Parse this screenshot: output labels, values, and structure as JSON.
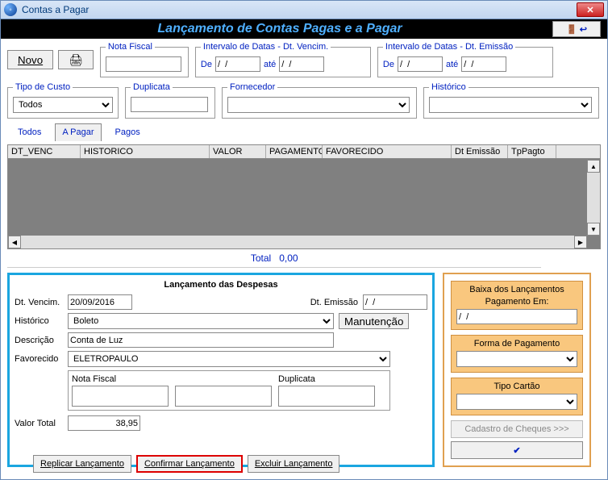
{
  "window": {
    "title": "Contas a Pagar"
  },
  "header": {
    "title": "Lançamento de Contas Pagas e a Pagar"
  },
  "buttons": {
    "novo": "Novo",
    "manutencao": "Manutenção",
    "replicar": "Replicar Lançamento",
    "confirmar": "Confirmar Lançamento",
    "excluir": "Excluir Lançamento",
    "cadastro_cheques": "Cadastro de Cheques >>>"
  },
  "filters": {
    "nota_fiscal_legend": "Nota Fiscal",
    "intervalo_venc_legend": "Intervalo de Datas - Dt. Vencim.",
    "intervalo_emis_legend": "Intervalo de Datas - Dt. Emissão",
    "de_label": "De",
    "ate_label": "até",
    "date_placeholder": "/  /",
    "tipo_custo_legend": "Tipo de Custo",
    "tipo_custo_value": "Todos",
    "duplicata_legend": "Duplicata",
    "fornecedor_legend": "Fornecedor",
    "historico_legend": "Histórico"
  },
  "tabs": {
    "todos": "Todos",
    "apagar": "A Pagar",
    "pagos": "Pagos"
  },
  "grid": {
    "columns": [
      "DT_VENC",
      "HISTORICO",
      "VALOR",
      "PAGAMENTO",
      "FAVORECIDO",
      "Dt Emissão",
      "TpPagto"
    ],
    "widths": [
      90,
      160,
      70,
      70,
      160,
      70,
      60
    ]
  },
  "total": {
    "label": "Total",
    "value": "0,00"
  },
  "despesas": {
    "title": "Lançamento das Despesas",
    "dt_vencim_label": "Dt. Vencim.",
    "dt_vencim_value": "20/09/2016",
    "dt_emissao_label": "Dt. Emissão",
    "dt_emissao_value": "/  /",
    "historico_label": "Histórico",
    "historico_value": "Boleto",
    "descricao_label": "Descrição",
    "descricao_value": "Conta de Luz",
    "favorecido_label": "Favorecido",
    "favorecido_value": "ELETROPAULO",
    "nota_fiscal_label": "Nota Fiscal",
    "duplicata_label": "Duplicata",
    "valor_total_label": "Valor Total",
    "valor_total_value": "38,95"
  },
  "baixa": {
    "titulo": "Baixa dos Lançamentos",
    "pagamento_em": "Pagamento  Em:",
    "pagamento_value": "/  /",
    "forma_label": "Forma de Pagamento",
    "tipo_cartao_label": "Tipo Cartão"
  }
}
